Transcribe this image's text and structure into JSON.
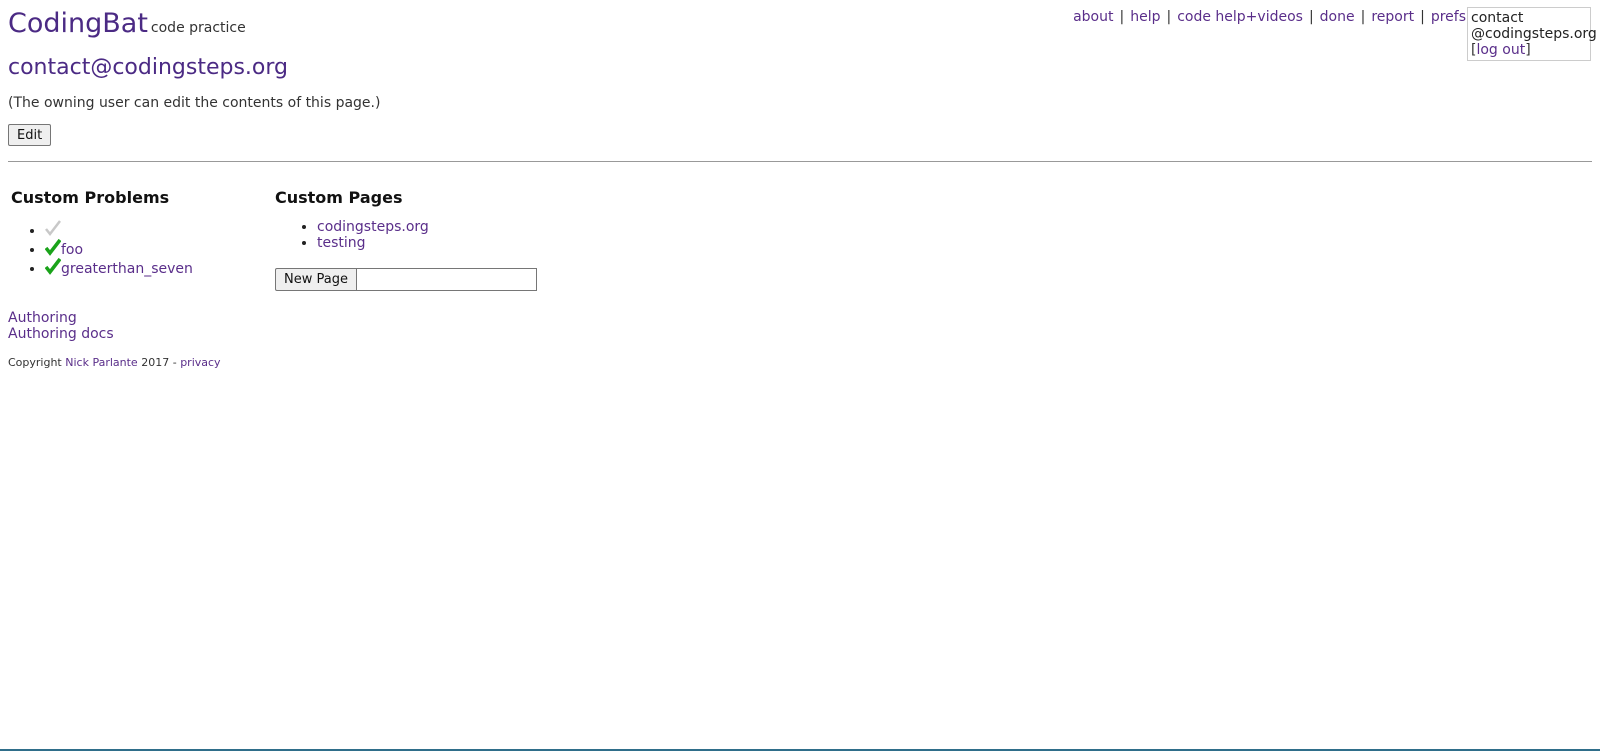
{
  "header": {
    "logo": "CodingBat",
    "tagline": "code practice"
  },
  "nav": {
    "items": [
      "about",
      "help",
      "code help+videos",
      "done",
      "report",
      "prefs"
    ],
    "separator": "|"
  },
  "user": {
    "name_line1": "contact",
    "name_line2": "@codingsteps.org",
    "logout_open": "[",
    "logout_label": "log out",
    "logout_close": "]"
  },
  "owner": {
    "title": "contact@codingsteps.org",
    "note": "(The owning user can edit the contents of this page.)",
    "edit_label": "Edit"
  },
  "problems": {
    "heading": "Custom Problems",
    "items": [
      {
        "label": "",
        "status": "gray-check-icon"
      },
      {
        "label": "foo",
        "status": "green-check-icon"
      },
      {
        "label": "greaterthan_seven",
        "status": "green-check-icon"
      }
    ]
  },
  "pages": {
    "heading": "Custom Pages",
    "items": [
      "codingsteps.org",
      "testing"
    ],
    "new_page_label": "New Page",
    "new_page_value": ""
  },
  "footer": {
    "authoring": "Authoring",
    "authoring_docs": "Authoring docs",
    "copyright_prefix": "Copyright",
    "author": "Nick Parlante",
    "year": "2017",
    "dash": "-",
    "privacy": "privacy"
  },
  "colors": {
    "link": "#5a2e8a",
    "logo": "#4b2a84",
    "check_green": "#1aa31a",
    "check_gray": "#c8c8c8"
  }
}
